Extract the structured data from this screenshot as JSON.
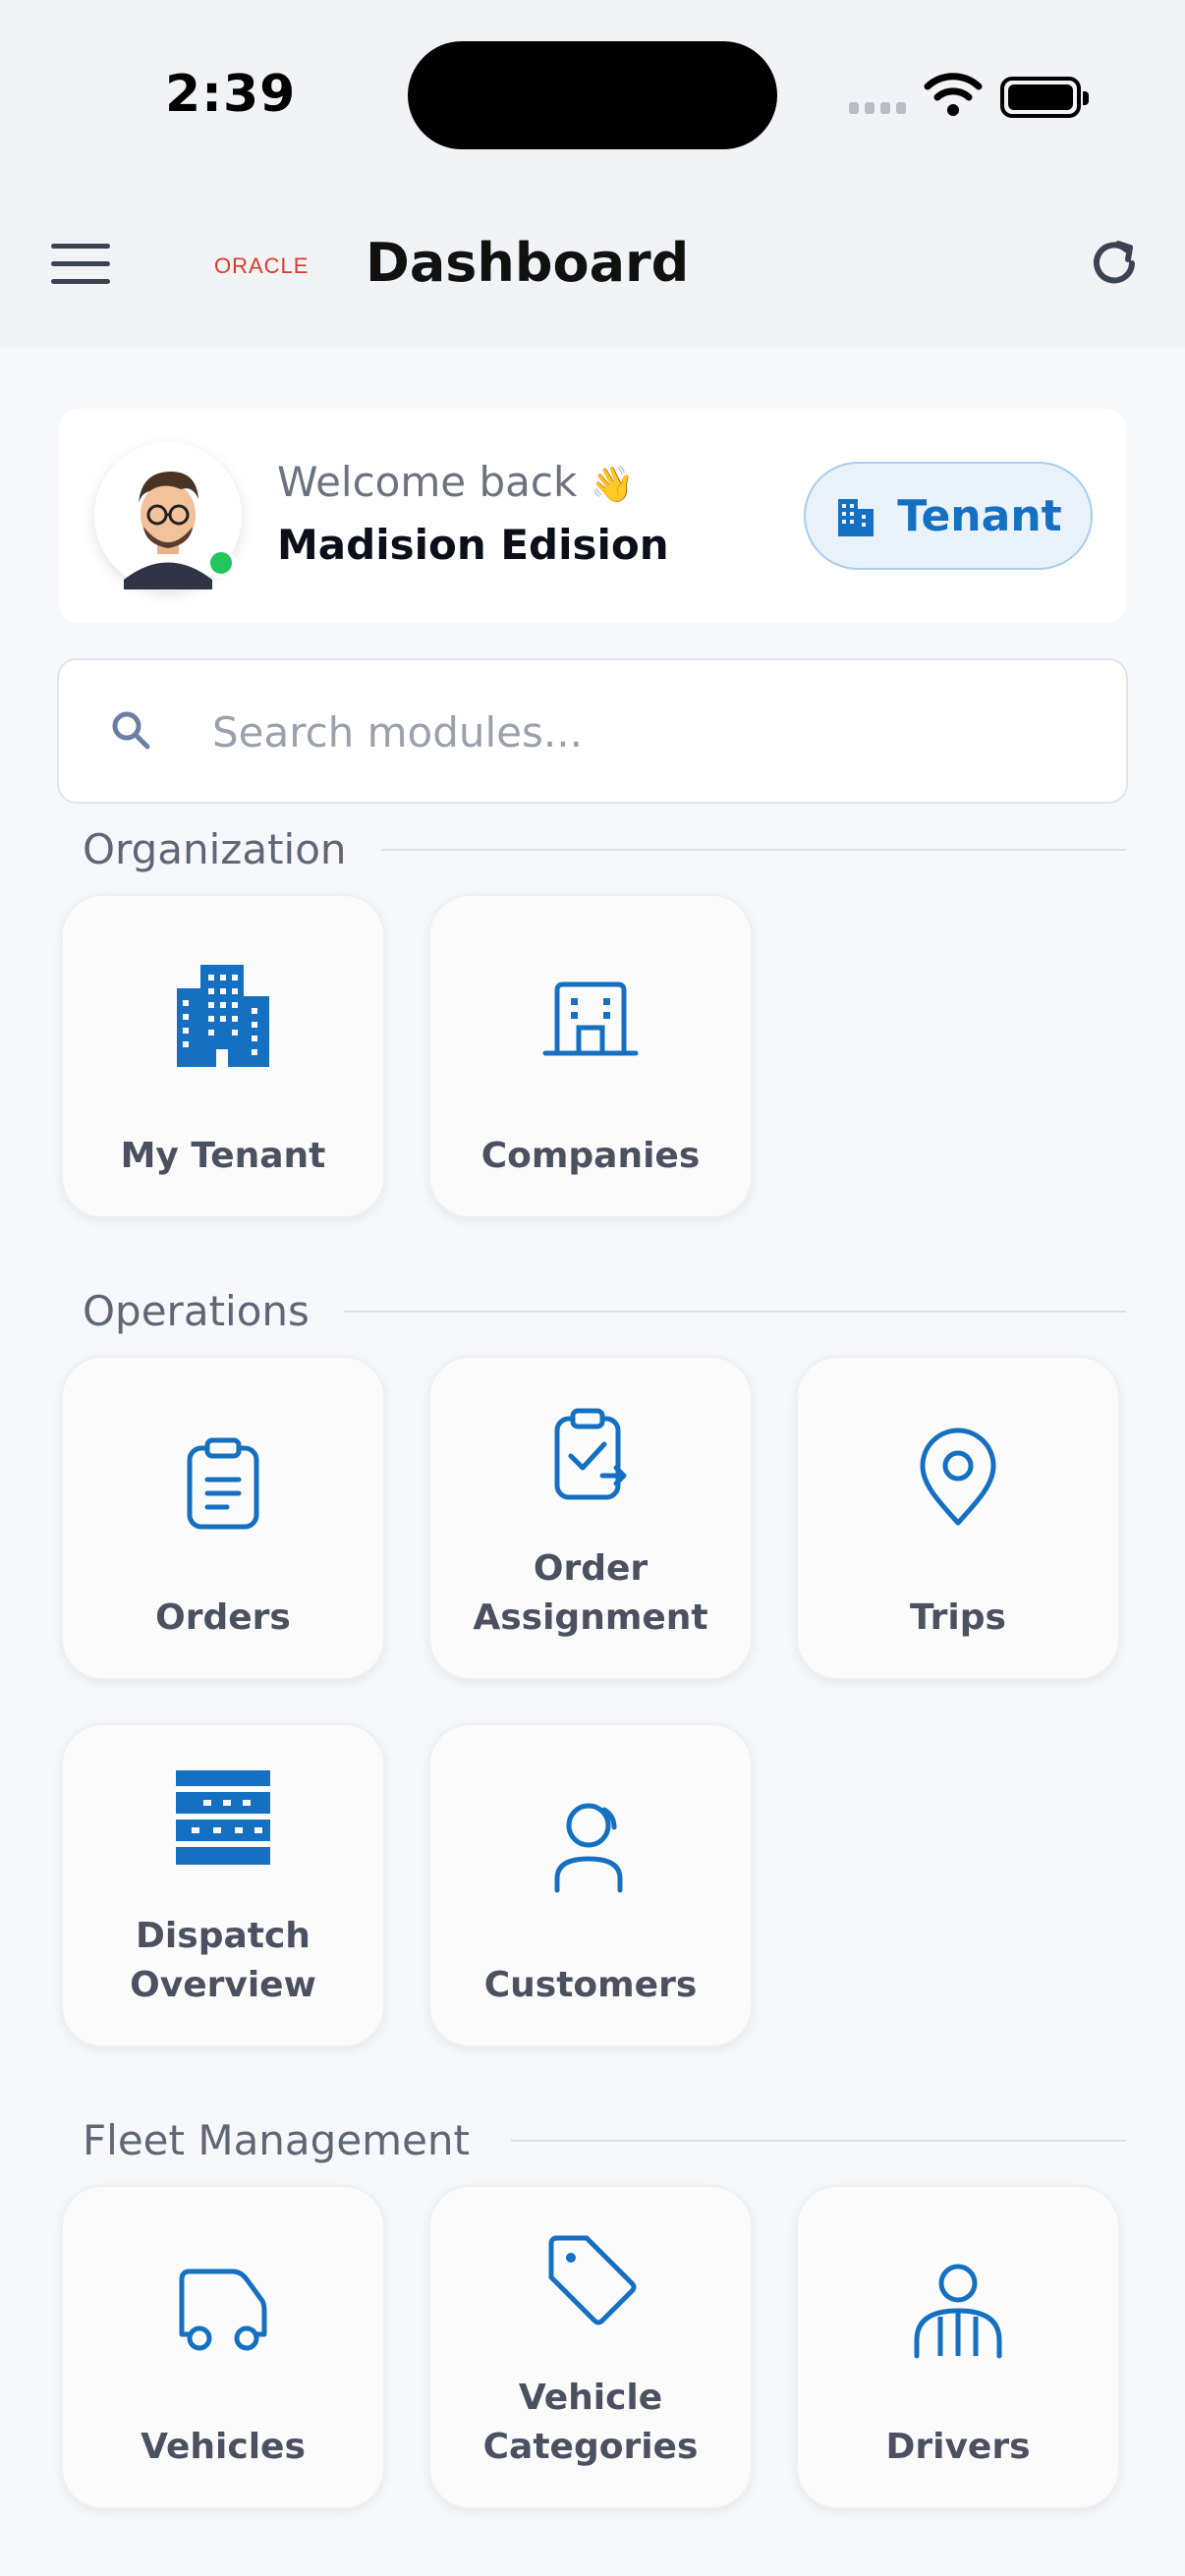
{
  "status_bar": {
    "time": "2:39"
  },
  "header": {
    "brand": "ORACLE",
    "title": "Dashboard"
  },
  "welcome": {
    "greeting": "Welcome back",
    "wave": "👋",
    "user_name": "Madision Edision",
    "role_button": "Tenant"
  },
  "search": {
    "placeholder": "Search modules..."
  },
  "sections": [
    {
      "title": "Organization",
      "modules": [
        "My Tenant",
        "Companies"
      ]
    },
    {
      "title": "Operations",
      "modules": [
        "Orders",
        "Order Assignment",
        "Trips",
        "Dispatch Overview",
        "Customers"
      ]
    },
    {
      "title": "Fleet Management",
      "modules": [
        "Vehicles",
        "Vehicle Categories",
        "Drivers"
      ]
    }
  ],
  "colors": {
    "accent": "#1570c2",
    "online": "#22c55e",
    "background": "#f6f8fb"
  }
}
